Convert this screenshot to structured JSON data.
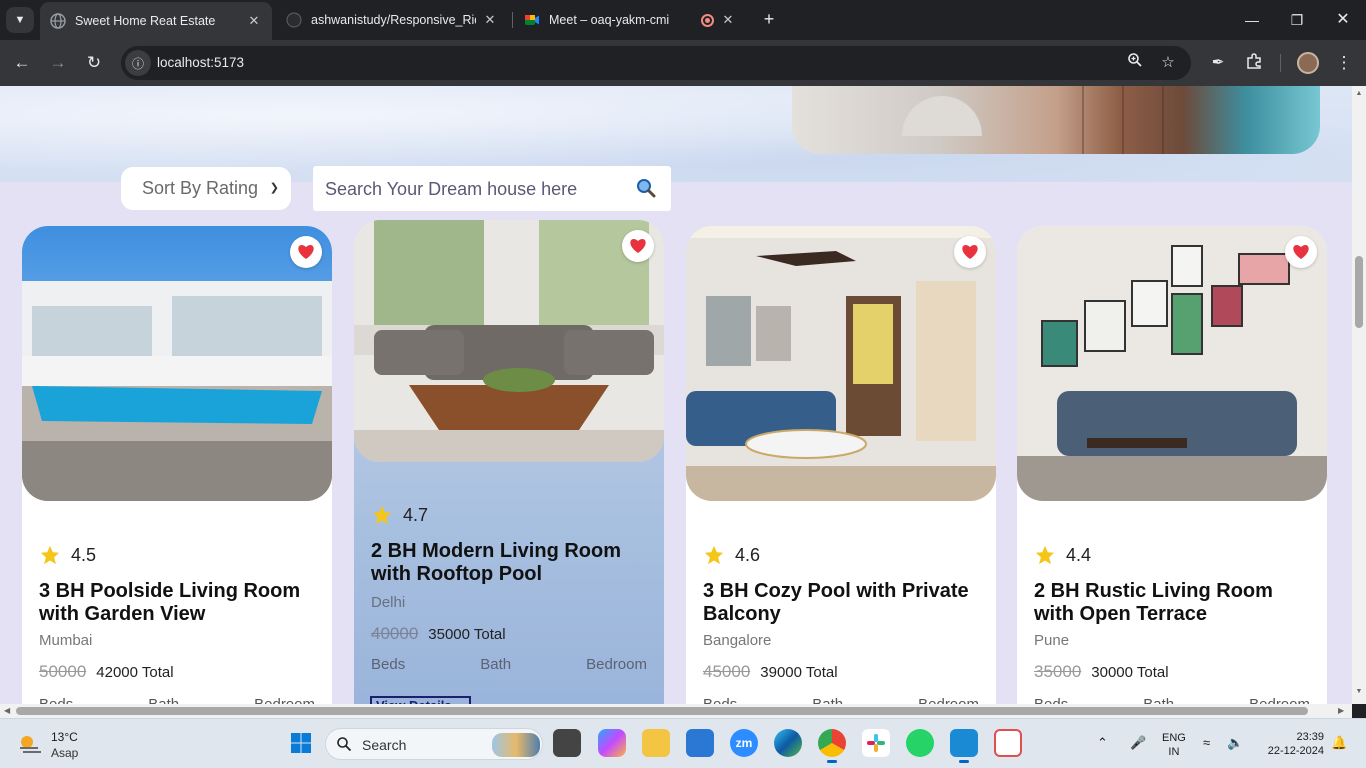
{
  "browser": {
    "tabs": [
      {
        "title": "Sweet Home Reat Estate",
        "active": true
      },
      {
        "title": "ashwanistudy/Responsive_Ride",
        "active": false
      },
      {
        "title": "Meet – oaq-yakm-cmi",
        "active": false
      },
      {
        "title": "",
        "active": false
      }
    ],
    "url": "localhost:5173"
  },
  "page": {
    "sort_select": {
      "value": "Sort By Rating"
    },
    "search": {
      "placeholder": "Search Your Dream house here"
    },
    "listings": [
      {
        "rating": "4.5",
        "title": "3 BH Poolside Living Room with Garden View",
        "city": "Mumbai",
        "old_price": "50000",
        "new_price": "42000 Total",
        "features": [
          "Beds",
          "Bath",
          "Bedroom"
        ]
      },
      {
        "rating": "4.7",
        "title": "2 BH Modern Living Room with Rooftop Pool",
        "city": "Delhi",
        "old_price": "40000",
        "new_price": "35000 Total",
        "features": [
          "Beds",
          "Bath",
          "Bedroom"
        ],
        "button": "View Details"
      },
      {
        "rating": "4.6",
        "title": "3 BH Cozy Pool with Private Balcony",
        "city": "Bangalore",
        "old_price": "45000",
        "new_price": "39000 Total",
        "features": [
          "Beds",
          "Bath",
          "Bedroom"
        ]
      },
      {
        "rating": "4.4",
        "title": "2 BH Rustic Living Room with Open Terrace",
        "city": "Pune",
        "old_price": "35000",
        "new_price": "30000 Total",
        "features": [
          "Beds",
          "Bath",
          "Bedroom"
        ]
      }
    ]
  },
  "taskbar": {
    "weather": {
      "temp": "13°C",
      "desc": "Asap"
    },
    "search_label": "Search",
    "language": {
      "line1": "ENG",
      "line2": "IN"
    },
    "clock": {
      "time": "23:39",
      "date": "22-12-2024"
    }
  },
  "colors": {
    "accent": "#e8333f",
    "page_bg": "#e3e1f3",
    "star": "#f5c518"
  }
}
